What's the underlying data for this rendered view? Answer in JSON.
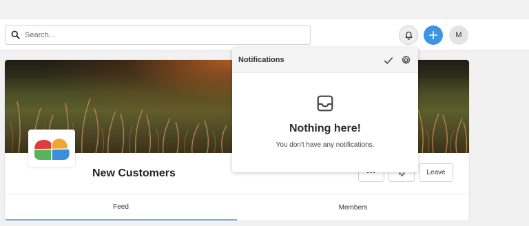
{
  "header": {
    "search_placeholder": "Search...",
    "avatar_initial": "M",
    "accent_color": "#3d94e0"
  },
  "group": {
    "name": "New Customers",
    "more_label": "•••",
    "leave_label": "Leave",
    "tabs": [
      {
        "label": "Feed",
        "active": true
      },
      {
        "label": "Members",
        "active": false
      }
    ]
  },
  "notifications": {
    "title": "Notifications",
    "empty_title": "Nothing here!",
    "empty_message": "You don't have any notifications."
  },
  "icons": [
    "search-icon",
    "bell-icon",
    "plus-icon",
    "checkmark-icon",
    "gear-icon",
    "inbox-icon",
    "cloud-logo"
  ]
}
